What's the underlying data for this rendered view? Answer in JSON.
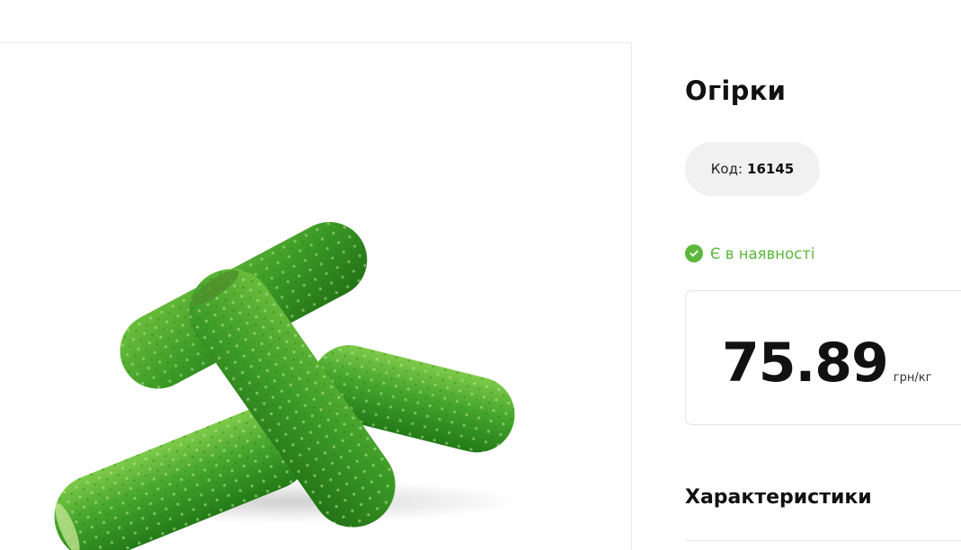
{
  "product": {
    "title": "Огірки",
    "code_label": "Код:",
    "code_value": "16145",
    "stock_status": "Є в наявності",
    "price": "75.89",
    "unit": "грн/кг",
    "image_alt": "cucumbers"
  },
  "sections": {
    "characteristics_title": "Характеристики"
  },
  "colors": {
    "in_stock_green": "#5cb83c",
    "pill_bg": "#f1f1f1",
    "cucumber_green": "#3f9a2a"
  }
}
